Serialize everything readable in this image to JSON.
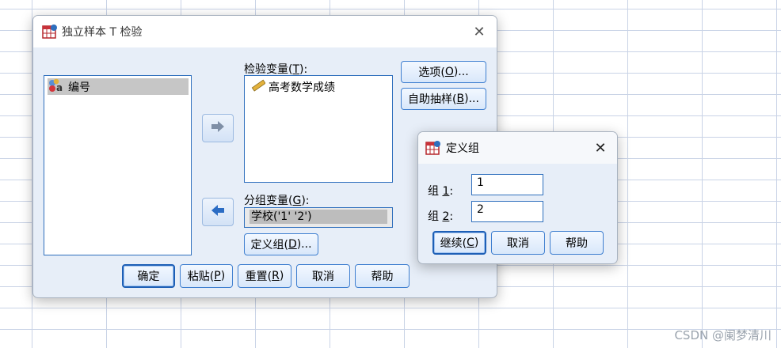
{
  "main_dialog": {
    "title": "独立样本 T 检验",
    "source_list": [
      {
        "label": "编号"
      }
    ],
    "test_vars_label_pre": "检验变量(",
    "test_vars_label_key": "T",
    "test_vars_label_post": "):",
    "test_vars": [
      {
        "label": "高考数学成绩"
      }
    ],
    "group_var_label_pre": "分组变量(",
    "group_var_label_key": "G",
    "group_var_label_post": "):",
    "group_var_value": "学校('1' '2')",
    "define_groups_btn": {
      "pre": "定义组(",
      "key": "D",
      "post": ")..."
    },
    "options_btn": {
      "pre": "选项(",
      "key": "O",
      "post": ")..."
    },
    "bootstrap_btn": {
      "pre": "自助抽样(",
      "key": "B",
      "post": ")..."
    },
    "footer": {
      "ok": "确定",
      "paste": {
        "pre": "粘贴(",
        "key": "P",
        "post": ")"
      },
      "reset": {
        "pre": "重置(",
        "key": "R",
        "post": ")"
      },
      "cancel": "取消",
      "help": "帮助"
    }
  },
  "define_groups_dialog": {
    "title": "定义组",
    "group1_label": {
      "pre": "组 ",
      "key": "1",
      "post": ":"
    },
    "group1_value": "1",
    "group2_label": {
      "pre": "组 ",
      "key": "2",
      "post": ":"
    },
    "group2_value": "2",
    "continue_btn": {
      "pre": "继续(",
      "key": "C",
      "post": ")"
    },
    "cancel": "取消",
    "help": "帮助"
  },
  "watermark": "CSDN @阑梦清川",
  "colors": {
    "accent": "#2f6fbd",
    "dialog_bg": "#e7eef8",
    "arrow_blue": "#2b6cc4"
  }
}
